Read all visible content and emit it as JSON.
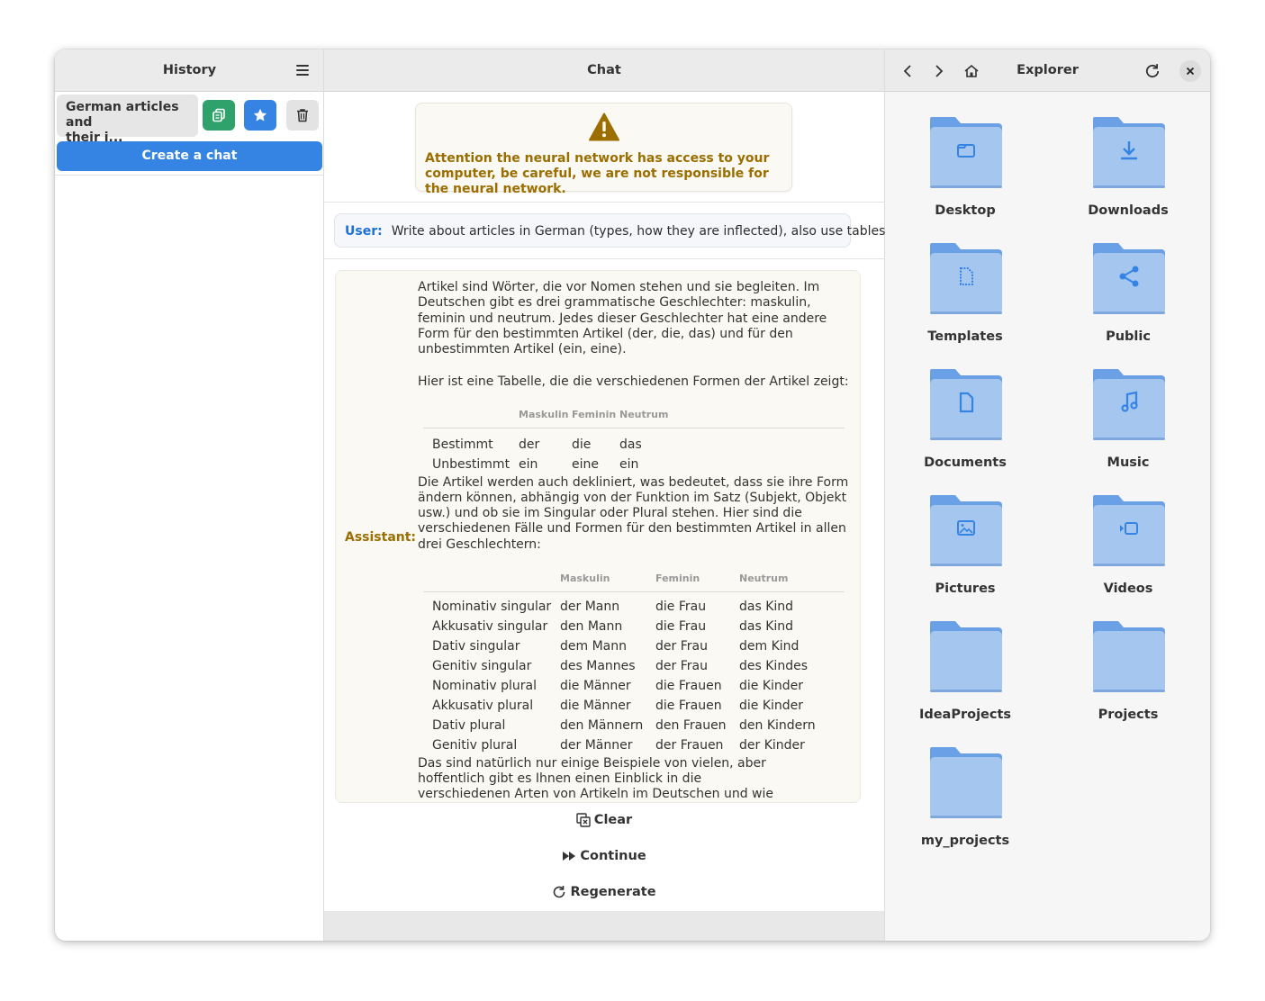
{
  "history": {
    "title": "History",
    "chats": [
      {
        "title_line1": "German articles and",
        "title_line2": "their i..."
      }
    ],
    "create_label": "Create a chat"
  },
  "chat": {
    "title": "Chat",
    "warning": "Attention the neural network has access to your computer, be careful, we are not responsible for the neural network.",
    "user_label": "User:",
    "user_message": "Write about articles in German (types, how they are inflected), also use tables.",
    "assistant_label": "Assistant:",
    "para1": "Artikel sind Wörter, die vor Nomen stehen und sie begleiten. Im Deutschen gibt es drei grammatische Geschlechter: maskulin, feminin und neutrum. Jedes dieser Geschlechter hat eine andere Form für den bestimmten Artikel (der, die, das) und für den unbestimmten Artikel (ein, eine).",
    "para2": "Hier ist eine Tabelle, die die verschiedenen Formen der Artikel zeigt:",
    "table1": {
      "headers": [
        "",
        "Maskulin",
        "Feminin",
        "Neutrum"
      ],
      "rows": [
        [
          "Bestimmt",
          "der",
          "die",
          "das"
        ],
        [
          "Unbestimmt",
          "ein",
          "eine",
          "ein"
        ]
      ]
    },
    "para3": "Die Artikel werden auch dekliniert, was bedeutet, dass sie ihre Form ändern können, abhängig von der Funktion im Satz (Subjekt, Objekt usw.) und ob sie im Singular oder Plural stehen. Hier sind die verschiedenen Fälle und Formen für den bestimmten Artikel in allen drei Geschlechtern:",
    "table2": {
      "headers": [
        "",
        "Maskulin",
        "Feminin",
        "Neutrum"
      ],
      "rows": [
        [
          "Nominativ  singular",
          "der Mann",
          "die Frau",
          "das Kind"
        ],
        [
          "Akkusativ singular",
          "den Mann",
          "die Frau",
          "das Kind"
        ],
        [
          "Dativ singular",
          "dem Mann",
          "der Frau",
          "dem Kind"
        ],
        [
          "Genitiv singular",
          "des Mannes",
          "der Frau",
          "des Kindes"
        ],
        [
          "Nominativ plural",
          "die Männer",
          "die Frauen",
          "die Kinder"
        ],
        [
          "Akkusativ plural",
          "die Männer",
          "die Frauen",
          "die Kinder"
        ],
        [
          "Dativ plural",
          "den Männern",
          "den Frauen",
          "den Kindern"
        ],
        [
          "Genitiv plural",
          "der Männer",
          "der Frauen",
          "der Kinder"
        ]
      ]
    },
    "para4": "Das sind natürlich nur einige Beispiele von vielen, aber hoffentlich gibt es Ihnen einen Einblick in die verschiedenen Arten von Artikeln im Deutschen und wie sie dekliniert werden.",
    "actions": {
      "clear": "Clear",
      "continue": "Continue",
      "regenerate": "Regenerate"
    }
  },
  "explorer": {
    "title": "Explorer",
    "folders": [
      {
        "label": "Desktop",
        "icon": "folder-icon"
      },
      {
        "label": "Downloads",
        "icon": "download-icon"
      },
      {
        "label": "Templates",
        "icon": "template-icon"
      },
      {
        "label": "Public",
        "icon": "share-icon"
      },
      {
        "label": "Documents",
        "icon": "document-icon"
      },
      {
        "label": "Music",
        "icon": "music-icon"
      },
      {
        "label": "Pictures",
        "icon": "picture-icon"
      },
      {
        "label": "Videos",
        "icon": "video-icon"
      },
      {
        "label": "IdeaProjects",
        "icon": ""
      },
      {
        "label": "Projects",
        "icon": ""
      },
      {
        "label": "my_projects",
        "icon": ""
      }
    ],
    "colors": {
      "folder": "#a4c6ef",
      "folder_tab": "#6aa1e6",
      "emblem": "#3584e4"
    }
  },
  "colors": {
    "accent": "#3584e4",
    "success": "#2ea26a",
    "warning_text": "#9c6e00"
  }
}
